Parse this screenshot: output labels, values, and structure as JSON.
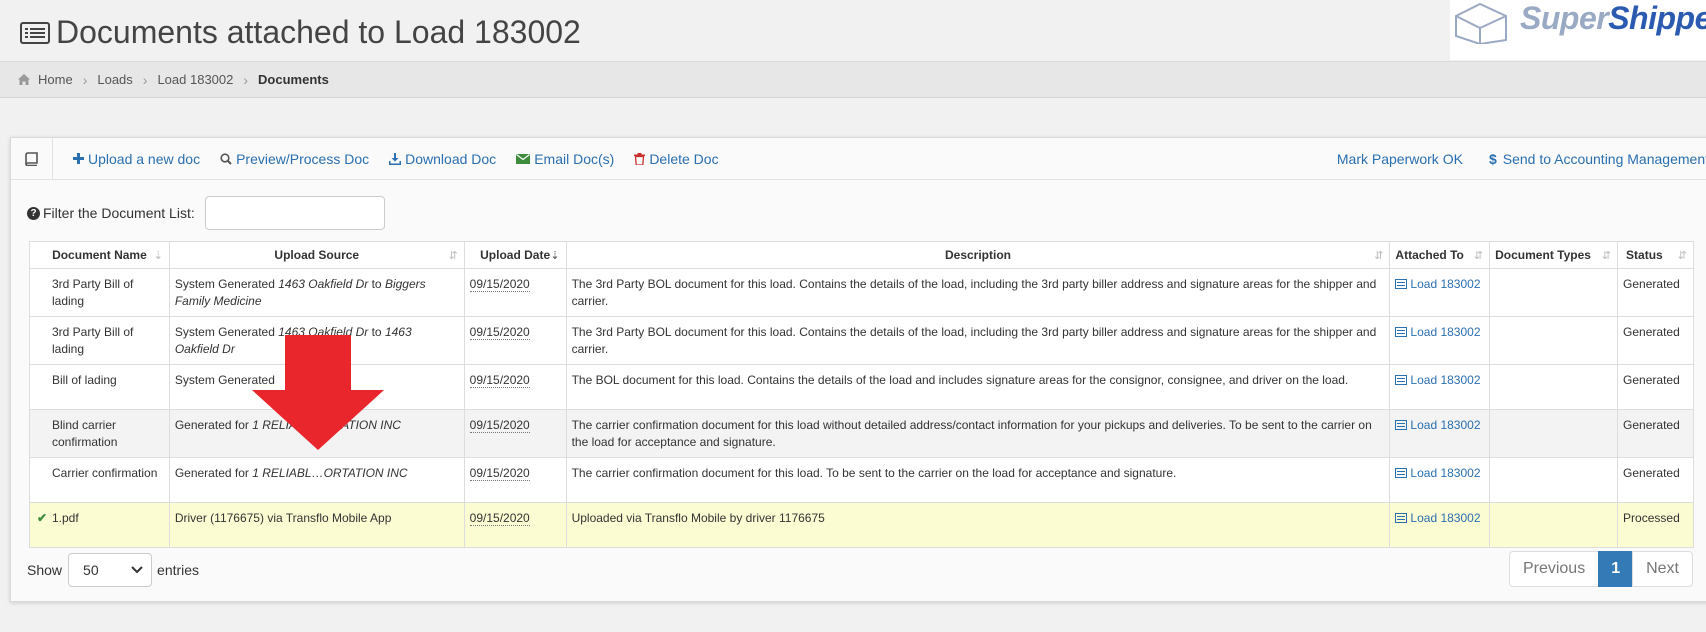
{
  "header": {
    "title": "Documents attached to Load 183002"
  },
  "logo": {
    "word1": "Super",
    "word2": "Shipper"
  },
  "breadcrumb": {
    "home": "Home",
    "loads": "Loads",
    "load": "Load 183002",
    "current": "Documents"
  },
  "toolbar": {
    "upload": "Upload a new doc",
    "preview": "Preview/Process Doc",
    "download": "Download Doc",
    "email": "Email Doc(s)",
    "delete": "Delete Doc",
    "mark_ok": "Mark Paperwork OK",
    "send_accounting": "Send to Accounting Management"
  },
  "filter": {
    "label": "Filter the Document List:"
  },
  "table": {
    "headers": {
      "name": "Document Name",
      "source": "Upload Source",
      "date": "Upload Date",
      "description": "Description",
      "attached": "Attached To",
      "types": "Document Types",
      "status": "Status"
    },
    "rows": [
      {
        "name": "3rd Party Bill of lading",
        "src_pre": "System Generated ",
        "src_a": "1463 Oakfield Dr",
        "src_mid": " to ",
        "src_b": "Biggers Family Medicine",
        "date": "09/15/2020",
        "description": "The 3rd Party BOL document for this load. Contains the details of the load, including the 3rd party biller address and signature areas for the shipper and carrier.",
        "attached": "Load 183002",
        "types": "",
        "status": "Generated"
      },
      {
        "name": "3rd Party Bill of lading",
        "src_pre": "System Generated ",
        "src_a": "1463 Oakfield Dr",
        "src_mid": " to ",
        "src_b": "1463 Oakfield Dr",
        "date": "09/15/2020",
        "description": "The 3rd Party BOL document for this load. Contains the details of the load, including the 3rd party biller address and signature areas for the shipper and carrier.",
        "attached": "Load 183002",
        "types": "",
        "status": "Generated"
      },
      {
        "name": "Bill of lading",
        "src_pre": "System Generated",
        "src_a": "",
        "src_mid": "",
        "src_b": "",
        "date": "09/15/2020",
        "description": "The BOL document for this load. Contains the details of the load and includes signature areas for the consignor, consignee, and driver on the load.",
        "attached": "Load 183002",
        "types": "",
        "status": "Generated"
      },
      {
        "name": "Blind carrier confirmation",
        "src_pre": "Generated for ",
        "src_a": "1 RELIAB…ORTATION INC",
        "src_mid": "",
        "src_b": "",
        "date": "09/15/2020",
        "description": "The carrier confirmation document for this load without detailed address/contact information for your pickups and deliveries. To be sent to the carrier on the load for acceptance and signature.",
        "attached": "Load 183002",
        "types": "",
        "status": "Generated"
      },
      {
        "name": "Carrier confirmation",
        "src_pre": "Generated for ",
        "src_a": "1 RELIABL…ORTATION INC",
        "src_mid": "",
        "src_b": "",
        "date": "09/15/2020",
        "description": "The carrier confirmation document for this load. To be sent to the carrier on the load for acceptance and signature.",
        "attached": "Load 183002",
        "types": "",
        "status": "Generated"
      },
      {
        "name": "1.pdf",
        "src_pre": "Driver (1176675) via Transflo Mobile App",
        "src_a": "",
        "src_mid": "",
        "src_b": "",
        "date": "09/15/2020",
        "description": "Uploaded via Transflo Mobile by driver 1176675",
        "attached": "Load 183002",
        "types": "",
        "status": "Processed"
      }
    ]
  },
  "footer": {
    "show": "Show",
    "entries_value": "50",
    "entries": "entries",
    "previous": "Previous",
    "page": "1",
    "next": "Next"
  },
  "colors": {
    "link": "#2a6fb0",
    "highlight_row": "#fcfcd2",
    "arrow": "#e8262b",
    "active_page": "#337ab7"
  }
}
